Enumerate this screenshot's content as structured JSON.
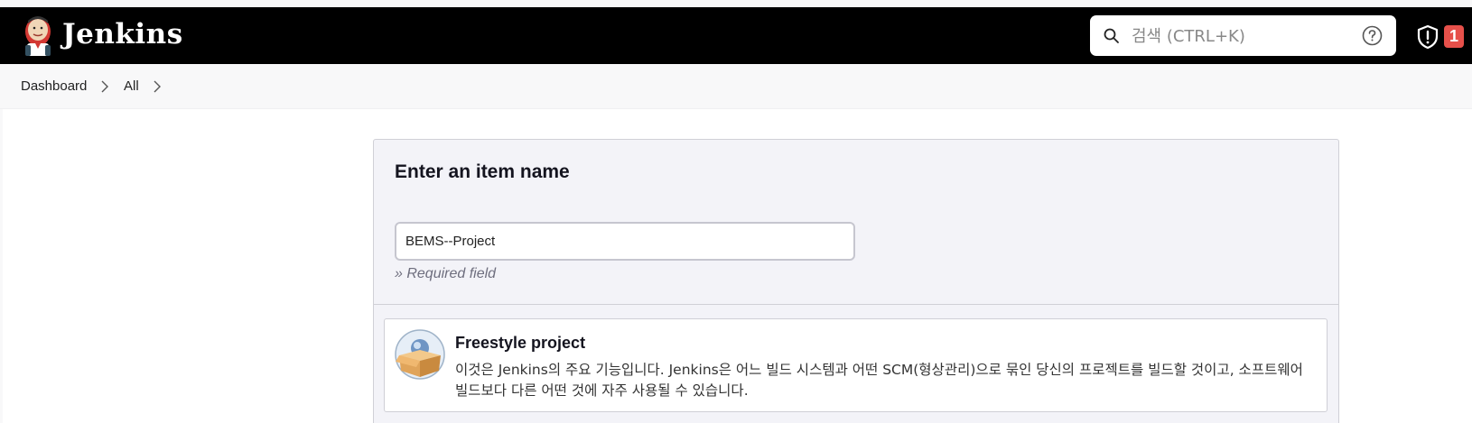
{
  "header": {
    "brand": "Jenkins",
    "search": {
      "placeholder": "검색 (CTRL+K)",
      "value": ""
    },
    "notification_count": "1"
  },
  "breadcrumb": [
    {
      "label": "Dashboard"
    },
    {
      "label": "All"
    }
  ],
  "form": {
    "title": "Enter an item name",
    "item_name_value": "BEMS--Project",
    "required_text": "» Required field"
  },
  "item_types": [
    {
      "title": "Freestyle project",
      "description": "이것은 Jenkins의 주요 기능입니다. Jenkins은 어느 빌드 시스템과 어떤 SCM(형상관리)으로 묶인 당신의 프로젝트를 빌드할 것이고, 소프트웨어 빌드보다 다른 어떤 것에 자주 사용될 수 있습니다.",
      "icon": "freestyle-project-icon"
    }
  ],
  "colors": {
    "header_bg": "#000000",
    "badge_bg": "#e6504a",
    "panel_bg": "#f3f3f8"
  }
}
